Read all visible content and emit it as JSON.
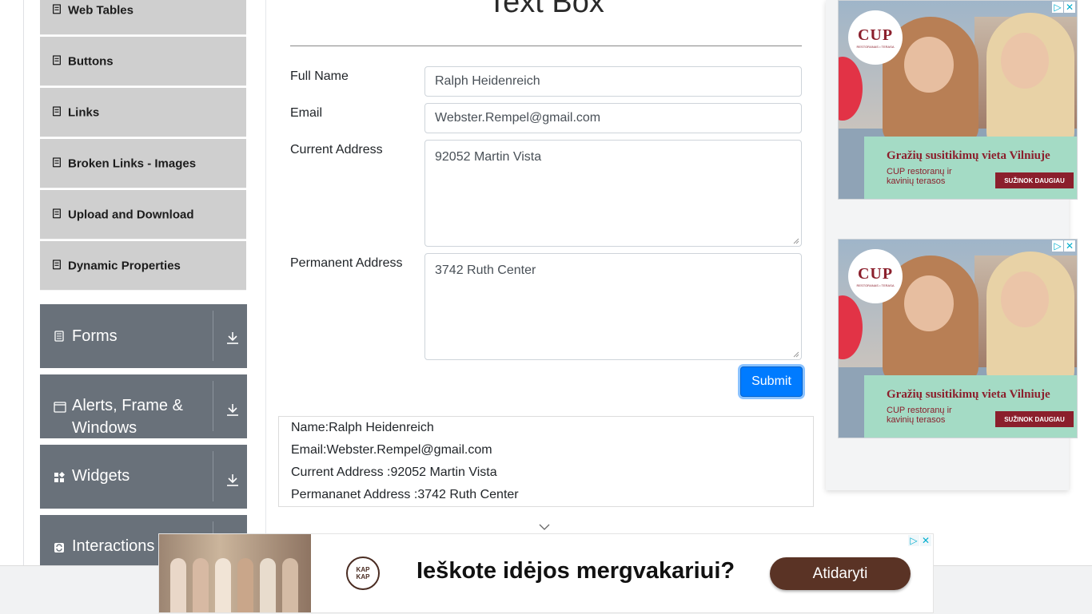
{
  "sidebar": {
    "elements_items": [
      {
        "label": "Web Tables",
        "icon": "document-icon"
      },
      {
        "label": "Buttons",
        "icon": "document-icon"
      },
      {
        "label": "Links",
        "icon": "document-icon"
      },
      {
        "label": "Broken Links - Images",
        "icon": "document-icon"
      },
      {
        "label": "Upload and Download",
        "icon": "document-icon"
      },
      {
        "label": "Dynamic Properties",
        "icon": "document-icon"
      }
    ],
    "groups": [
      {
        "label": "Forms",
        "icon": "form-icon"
      },
      {
        "label": "Alerts, Frame & Windows",
        "icon": "window-icon"
      },
      {
        "label": "Widgets",
        "icon": "widgets-icon"
      },
      {
        "label": "Interactions",
        "icon": "interactions-icon"
      }
    ]
  },
  "main": {
    "title": "Text Box",
    "fields": {
      "full_name_label": "Full Name",
      "full_name_value": "Ralph Heidenreich",
      "email_label": "Email",
      "email_value": "Webster.Rempel@gmail.com",
      "current_address_label": "Current Address",
      "current_address_value": "92052 Martin Vista",
      "permanent_address_label": "Permanent Address",
      "permanent_address_value": "3742 Ruth Center"
    },
    "submit_label": "Submit",
    "output": {
      "name": "Name:Ralph Heidenreich",
      "email": "Email:Webster.Rempel@gmail.com",
      "current_address": "Current Address :92052 Martin Vista",
      "permanent_address": "Permananet Address :3742 Ruth Center"
    }
  },
  "ads": {
    "side_ad": {
      "logo": "CUP",
      "logo_sub": "RESTORANAS • TERASA",
      "headline": "Gražių susitikimų vieta Vilniuje",
      "sub": "CUP restoranų ir kavinių terasos",
      "button": "SUŽINOK DAUGIAU"
    },
    "bottom_ad": {
      "logo_line1": "KAP",
      "logo_line2": "KAP",
      "text": "Ieškote idėjos mergvakariui?",
      "button": "Atidaryti"
    },
    "ad_choices_icon": "ad-choices-icon",
    "close_icon": "close-icon"
  },
  "colors": {
    "sidebar_sub_bg": "#cfcfcf",
    "sidebar_group_bg": "#69717a",
    "submit_bg": "#007bff",
    "ad_accent": "#8b1f2c",
    "bottom_ad_button": "#5a3325"
  }
}
